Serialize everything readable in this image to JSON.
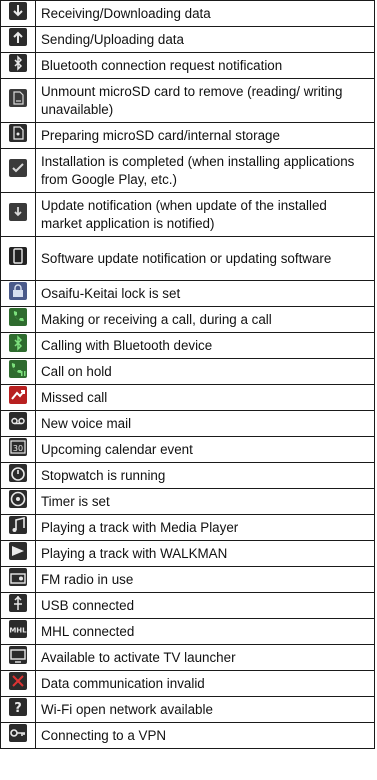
{
  "rows": [
    {
      "text": "Receiving/Downloading data",
      "icon": "download-data-icon",
      "bg": "#2b2b2b",
      "fg": "#e8e8e8",
      "h": 26
    },
    {
      "text": "Sending/Uploading data",
      "icon": "upload-data-icon",
      "bg": "#2b2b2b",
      "fg": "#e8e8e8",
      "h": 26
    },
    {
      "text": "Bluetooth connection request notification",
      "icon": "bluetooth-request-icon",
      "bg": "#2b2b2b",
      "fg": "#e8e8e8",
      "h": 26
    },
    {
      "text": "Unmount microSD card to remove (reading/ writing unavailable)",
      "icon": "sd-card-unmount-icon",
      "bg": "#3a3a3a",
      "fg": "#d8d8d8",
      "h": 44
    },
    {
      "text": "Preparing microSD card/internal storage",
      "icon": "sd-card-prepare-icon",
      "bg": "#2b2b2b",
      "fg": "#e8e8e8",
      "h": 26
    },
    {
      "text": "Installation is completed (when installing applications from Google Play, etc.)",
      "icon": "install-complete-icon",
      "bg": "#3a3a3a",
      "fg": "#d8d8d8",
      "h": 44
    },
    {
      "text": "Update notification (when update of the installed market application is notified)",
      "icon": "update-notification-icon",
      "bg": "#3a3a3a",
      "fg": "#d8d8d8",
      "h": 44
    },
    {
      "text": "Software update notification or updating software",
      "icon": "software-update-icon",
      "bg": "#222222",
      "fg": "#e8e8e8",
      "h": 44
    },
    {
      "text": "Osaifu-Keitai lock is set",
      "icon": "osaifu-lock-icon",
      "bg": "#4a5a8a",
      "fg": "#d8e0f0",
      "h": 26
    },
    {
      "text": "Making or receiving a call, during a call",
      "icon": "phone-call-icon",
      "bg": "#2e6b2e",
      "fg": "#7de07d",
      "h": 26
    },
    {
      "text": "Calling with Bluetooth device",
      "icon": "bluetooth-call-icon",
      "bg": "#2e6b2e",
      "fg": "#7de07d",
      "h": 26
    },
    {
      "text": "Call on hold",
      "icon": "call-hold-icon",
      "bg": "#2e6b2e",
      "fg": "#7de07d",
      "h": 26
    },
    {
      "text": "Missed call",
      "icon": "missed-call-icon",
      "bg": "#b82020",
      "fg": "#ffffff",
      "h": 26
    },
    {
      "text": "New voice mail",
      "icon": "voicemail-icon",
      "bg": "#2b2b2b",
      "fg": "#e8e8e8",
      "h": 26
    },
    {
      "text": "Upcoming calendar event",
      "icon": "calendar-event-icon",
      "bg": "#2b2b2b",
      "fg": "#e8e8e8",
      "h": 26
    },
    {
      "text": "Stopwatch is running",
      "icon": "stopwatch-icon",
      "bg": "#2b2b2b",
      "fg": "#e8e8e8",
      "h": 26
    },
    {
      "text": "Timer is set",
      "icon": "timer-icon",
      "bg": "#2b2b2b",
      "fg": "#e8e8e8",
      "h": 26
    },
    {
      "text": "Playing a track with Media Player",
      "icon": "media-player-icon",
      "bg": "#2b2b2b",
      "fg": "#e8e8e8",
      "h": 26
    },
    {
      "text": "Playing a track with WALKMAN",
      "icon": "walkman-play-icon",
      "bg": "#2b2b2b",
      "fg": "#e8e8e8",
      "h": 26
    },
    {
      "text": "FM radio in use",
      "icon": "fm-radio-icon",
      "bg": "#2b2b2b",
      "fg": "#e8e8e8",
      "h": 26
    },
    {
      "text": "USB connected",
      "icon": "usb-icon",
      "bg": "#2b2b2b",
      "fg": "#e8e8e8",
      "h": 26
    },
    {
      "text": "MHL connected",
      "icon": "mhl-icon",
      "bg": "#2b2b2b",
      "fg": "#e8e8e8",
      "h": 26
    },
    {
      "text": "Available to activate TV launcher",
      "icon": "tv-launcher-icon",
      "bg": "#2b2b2b",
      "fg": "#e8e8e8",
      "h": 26
    },
    {
      "text": "Data communication invalid",
      "icon": "data-invalid-icon",
      "bg": "#2b2b2b",
      "fg": "#e8e8e8",
      "h": 26
    },
    {
      "text": "Wi-Fi open network available",
      "icon": "wifi-open-network-icon",
      "bg": "#2b2b2b",
      "fg": "#e8e8e8",
      "h": 26
    },
    {
      "text": "Connecting to a VPN",
      "icon": "vpn-key-icon",
      "bg": "#2b2b2b",
      "fg": "#e8e8e8",
      "h": 26
    }
  ]
}
